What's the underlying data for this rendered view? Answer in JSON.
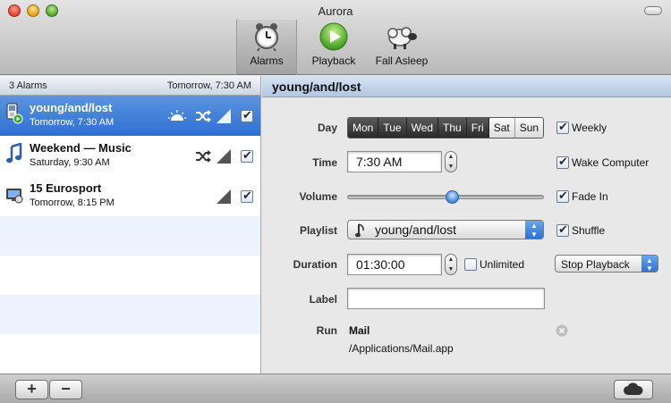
{
  "window": {
    "title": "Aurora"
  },
  "toolbar": {
    "alarms_label": "Alarms",
    "playback_label": "Playback",
    "fall_asleep_label": "Fall Asleep"
  },
  "sidebar": {
    "header_count": "3 Alarms",
    "header_next": "Tomorrow, 7:30 AM",
    "alarms": [
      {
        "name": "young/and/lost",
        "time": "Tomorrow, 7:30 AM",
        "icon": "ipod-play-icon",
        "enabled": true,
        "selected": true
      },
      {
        "name": "Weekend — Music",
        "time": "Saturday, 9:30 AM",
        "icon": "music-note-icon",
        "enabled": true,
        "selected": false
      },
      {
        "name": "15 Eurosport",
        "time": "Tomorrow, 8:15 PM",
        "icon": "tv-icon",
        "enabled": true,
        "selected": false
      }
    ]
  },
  "detail": {
    "title": "young/and/lost",
    "day": {
      "label": "Day",
      "days": [
        "Mon",
        "Tue",
        "Wed",
        "Thu",
        "Fri",
        "Sat",
        "Sun"
      ],
      "selected": [
        "Mon",
        "Tue",
        "Wed",
        "Thu",
        "Fri"
      ]
    },
    "weekly": {
      "label": "Weekly",
      "checked": true
    },
    "time": {
      "label": "Time",
      "value": "7:30 AM"
    },
    "wake_computer": {
      "label": "Wake Computer",
      "checked": true
    },
    "volume": {
      "label": "Volume",
      "level": 0.53
    },
    "fade_in": {
      "label": "Fade In",
      "checked": true
    },
    "playlist": {
      "label": "Playlist",
      "value": "young/and/lost"
    },
    "shuffle": {
      "label": "Shuffle",
      "checked": true
    },
    "duration": {
      "label": "Duration",
      "value": "01:30:00"
    },
    "unlimited": {
      "label": "Unlimited",
      "checked": false
    },
    "after_duration": {
      "value": "Stop Playback"
    },
    "alarm_label": {
      "label": "Label",
      "value": ""
    },
    "run": {
      "label": "Run",
      "app": "Mail",
      "path": "/Applications/Mail.app"
    }
  },
  "bottombar": {
    "add_label": "+",
    "remove_label": "−"
  },
  "colors": {
    "selection": "#3b7ad9",
    "accent": "#2f6fd2"
  }
}
